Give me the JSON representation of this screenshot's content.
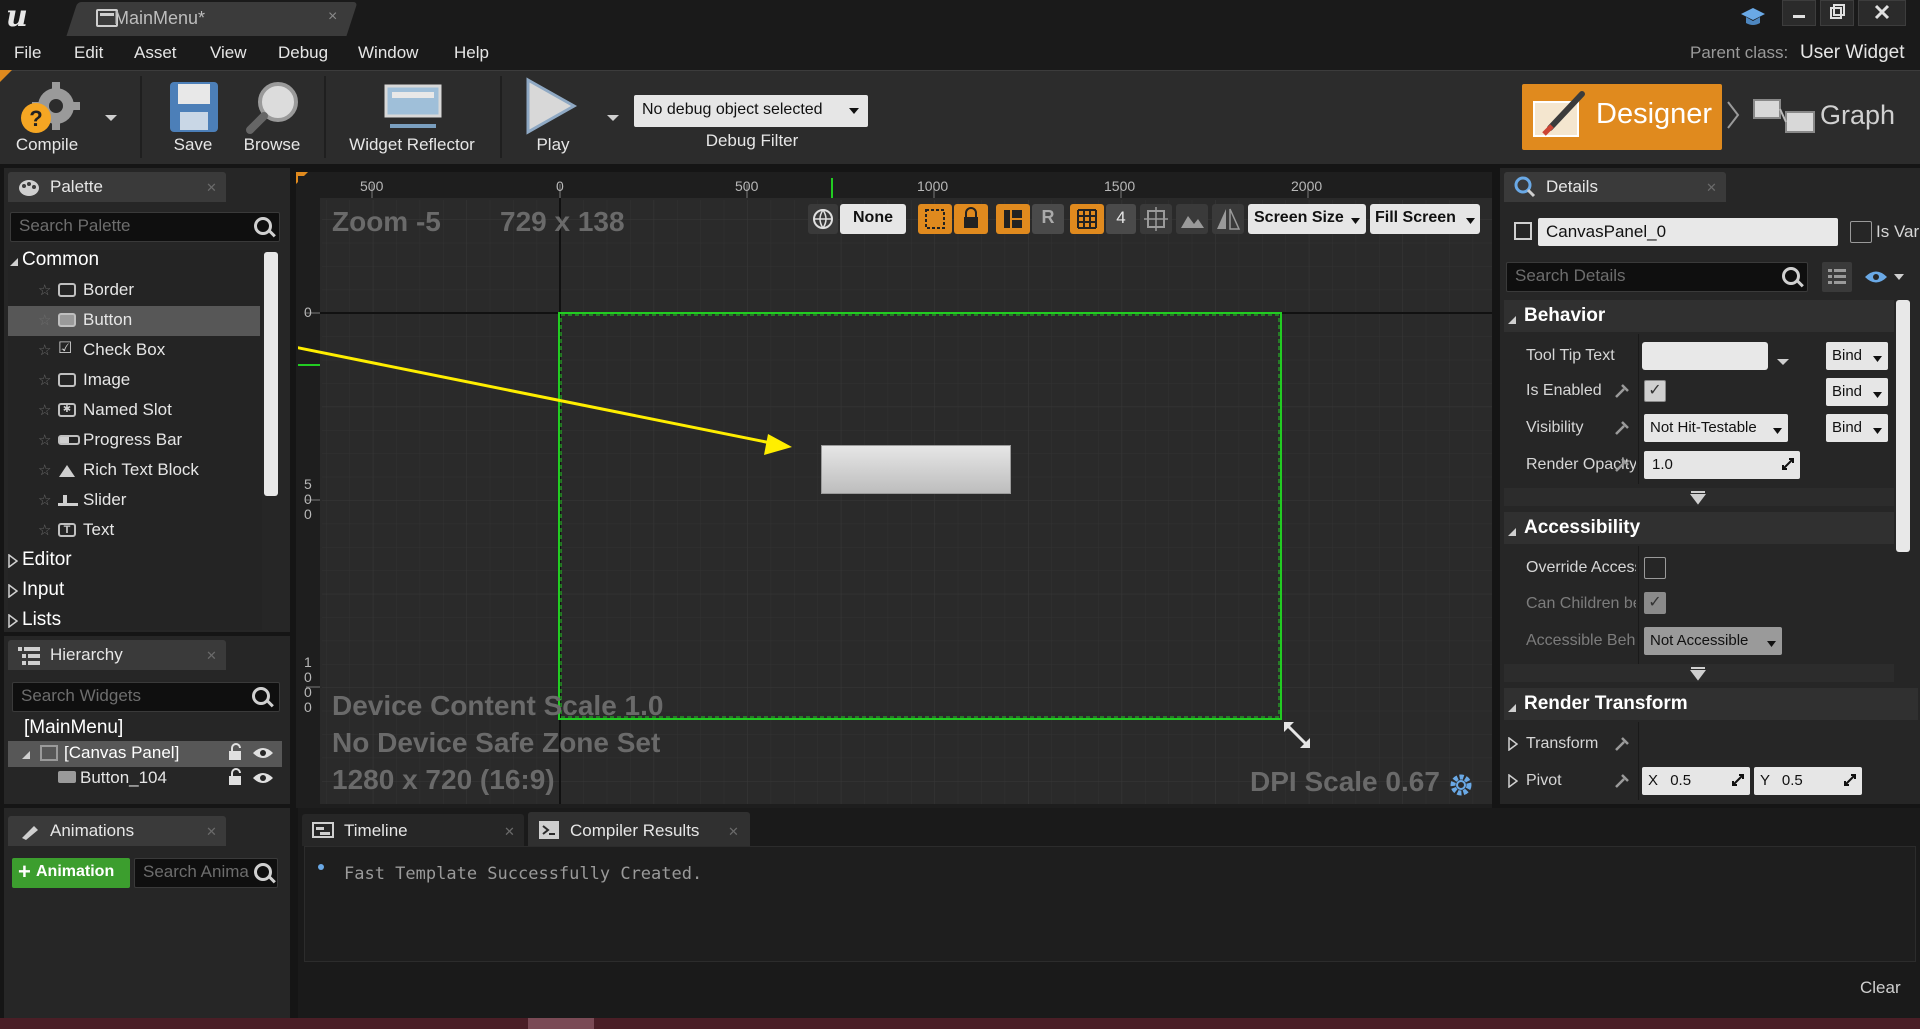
{
  "window": {
    "tab_title": "MainMenu*",
    "logo": "u",
    "tab_close": "×",
    "controls": [
      "minimize",
      "maximize",
      "close"
    ]
  },
  "menu": {
    "items": [
      "File",
      "Edit",
      "Asset",
      "View",
      "Debug",
      "Window",
      "Help"
    ],
    "parent_class_label": "Parent class:",
    "parent_class_value": "User Widget"
  },
  "toolbar": {
    "compile": "Compile",
    "save": "Save",
    "browse": "Browse",
    "widget_reflector": "Widget Reflector",
    "play": "Play",
    "debug_object": "No debug object selected",
    "debug_filter": "Debug Filter",
    "designer": "Designer",
    "graph": "Graph"
  },
  "palette": {
    "title": "Palette",
    "search_placeholder": "Search Palette",
    "categories": {
      "common": "Common",
      "editor": "Editor",
      "input": "Input",
      "lists": "Lists"
    },
    "items": [
      "Border",
      "Button",
      "Check Box",
      "Image",
      "Named Slot",
      "Progress Bar",
      "Rich Text Block",
      "Slider",
      "Text"
    ],
    "selected": "Button"
  },
  "hierarchy": {
    "title": "Hierarchy",
    "search_placeholder": "Search Widgets",
    "root": "[MainMenu]",
    "canvas_panel": "[Canvas Panel]",
    "button": "Button_104"
  },
  "animations": {
    "title": "Animations",
    "add_button": "Animation",
    "search_placeholder": "Search Anima"
  },
  "canvas": {
    "zoom": "Zoom -5",
    "resolution": "729 x 138",
    "top_ruler": [
      "500",
      "0",
      "500",
      "1000",
      "1500",
      "2000"
    ],
    "left_ruler_top": "0",
    "left_ruler_mid": [
      "5",
      "0",
      "0"
    ],
    "left_ruler_bottom": [
      "1",
      "0",
      "0",
      "0"
    ],
    "toolbar": {
      "none": "None",
      "r": "R",
      "grid_size": "4",
      "screen_size": "Screen Size",
      "fill_screen": "Fill Screen"
    },
    "device_content_scale": "Device Content Scale 1.0",
    "safe_zone": "No Device Safe Zone Set",
    "device_resolution": "1280 x 720 (16:9)",
    "dpi_scale": "DPI Scale 0.67"
  },
  "details": {
    "title": "Details",
    "widget_name": "CanvasPanel_0",
    "is_variable": "Is Var",
    "search_placeholder": "Search Details",
    "sections": {
      "behavior": "Behavior",
      "accessibility": "Accessibility",
      "render_transform": "Render Transform"
    },
    "behavior": {
      "tool_tip_text": "Tool Tip Text",
      "is_enabled": "Is Enabled",
      "visibility": "Visibility",
      "visibility_value": "Not Hit-Testable",
      "render_opacity": "Render Opacity",
      "render_opacity_value": "1.0",
      "bind": "Bind"
    },
    "accessibility": {
      "override_access": "Override Access",
      "can_children_be": "Can Children be",
      "accessible_behavior": "Accessible Beha",
      "accessible_value": "Not Accessible"
    },
    "render_transform": {
      "transform": "Transform",
      "pivot": "Pivot",
      "pivot_x_label": "X",
      "pivot_x": "0.5",
      "pivot_y_label": "Y",
      "pivot_y": "0.5"
    }
  },
  "bottom": {
    "tabs": [
      "Timeline",
      "Compiler Results"
    ],
    "message": "Fast Template Successfully Created.",
    "clear": "Clear"
  },
  "colors": {
    "accent": "#e08a1e",
    "selection_green": "#22cc22",
    "arrow_yellow": "#ffee00",
    "add_button_green": "#3c9e2e"
  }
}
